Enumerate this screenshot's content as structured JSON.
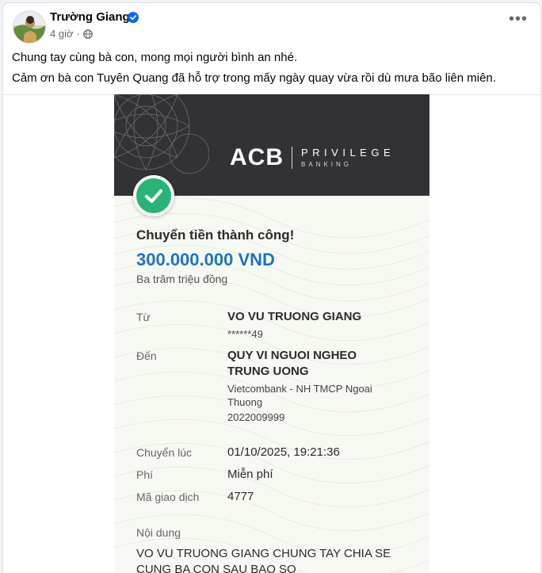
{
  "post": {
    "author": "Trường Giang",
    "time": "4 giờ",
    "time_separator": "·",
    "more_label": "•••",
    "caption_lines": [
      "Chung tay cùng bà con, mong mọi người bình an nhé.",
      "Cảm ơn bà con Tuyên Quang đã hỗ trợ trong mấy ngày quay vừa rồi dù mưa bão liên miên."
    ],
    "icons": {
      "verified": "verified-badge-icon",
      "audience": "globe-icon",
      "more": "more-options-icon"
    }
  },
  "receipt": {
    "logo": "ACB",
    "brand_line1": "PRIVILEGE",
    "brand_line2": "BANKING",
    "title": "Chuyển tiền thành công!",
    "amount": "300.000.000 VND",
    "amount_words": "Ba trăm triệu đồng",
    "from_label": "Từ",
    "from_name": "VO VU TRUONG GIANG",
    "from_account": "******49",
    "to_label": "Đến",
    "to_name_line1": "QUY VI NGUOI NGHEO",
    "to_name_line2": "TRUNG UONG",
    "to_bank_line1": "Vietcombank - NH TMCP Ngoai",
    "to_bank_line2": "Thuong",
    "to_account": "2022009999",
    "time_label": "Chuyển lúc",
    "time_value": "01/10/2025, 19:21:36",
    "fee_label": "Phí",
    "fee_value": "Miễn phí",
    "txn_label": "Mã giao dịch",
    "txn_value": "4777",
    "content_label": "Nội dung",
    "content_line1": "VO VU TRUONG GIANG CHUNG TAY CHIA SE",
    "content_line2": "CUNG BA CON SAU BAO SO",
    "colors": {
      "header_bg": "#323236",
      "success_green": "#27b475",
      "amount_blue": "#1f73c4"
    }
  }
}
